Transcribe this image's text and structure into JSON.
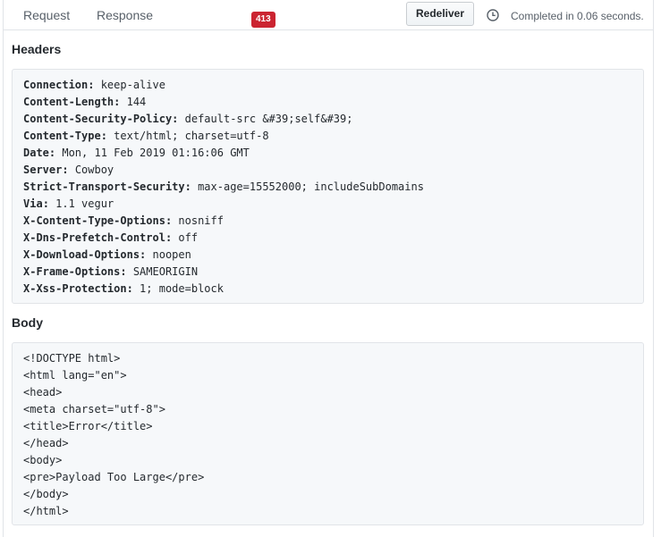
{
  "tabs": {
    "request_label": "Request",
    "response_label": "Response",
    "response_count": "413"
  },
  "toolbar": {
    "redeliver_label": "Redeliver",
    "status_text": "Completed in 0.06 seconds.",
    "clock_icon": "clock-icon"
  },
  "headers_section": {
    "title": "Headers",
    "items": [
      {
        "key": "Connection",
        "value": "keep-alive"
      },
      {
        "key": "Content-Length",
        "value": "144"
      },
      {
        "key": "Content-Security-Policy",
        "value": "default-src &#39;self&#39;"
      },
      {
        "key": "Content-Type",
        "value": "text/html; charset=utf-8"
      },
      {
        "key": "Date",
        "value": "Mon, 11 Feb 2019 01:16:06 GMT"
      },
      {
        "key": "Server",
        "value": "Cowboy"
      },
      {
        "key": "Strict-Transport-Security",
        "value": "max-age=15552000; includeSubDomains"
      },
      {
        "key": "Via",
        "value": "1.1 vegur"
      },
      {
        "key": "X-Content-Type-Options",
        "value": "nosniff"
      },
      {
        "key": "X-Dns-Prefetch-Control",
        "value": "off"
      },
      {
        "key": "X-Download-Options",
        "value": "noopen"
      },
      {
        "key": "X-Frame-Options",
        "value": "SAMEORIGIN"
      },
      {
        "key": "X-Xss-Protection",
        "value": "1; mode=block"
      }
    ]
  },
  "body_section": {
    "title": "Body",
    "lines": [
      "<!DOCTYPE html>",
      "<html lang=\"en\">",
      "<head>",
      "<meta charset=\"utf-8\">",
      "<title>Error</title>",
      "</head>",
      "<body>",
      "<pre>Payload Too Large</pre>",
      "</body>",
      "</html>"
    ]
  },
  "colors": {
    "counter_bg": "#cb2431",
    "code_bg": "#f6f8fa",
    "border": "#e1e4e8"
  }
}
